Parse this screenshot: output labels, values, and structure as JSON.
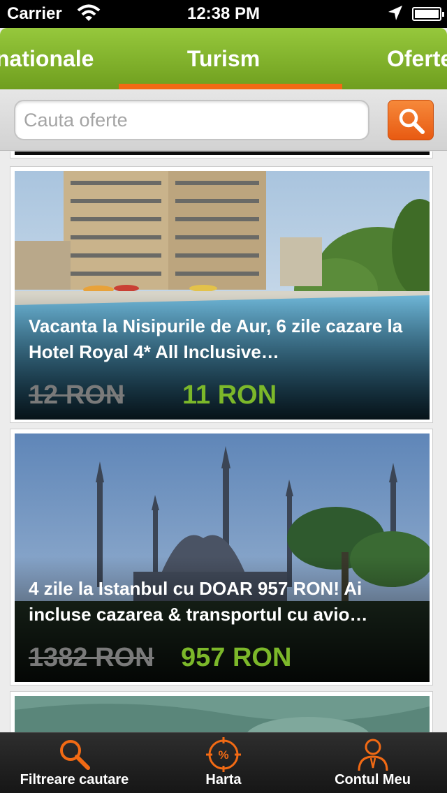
{
  "status_bar": {
    "carrier": "Carrier",
    "time": "12:38 PM"
  },
  "top_tabs": [
    {
      "label": "nationale"
    },
    {
      "label": "Turism"
    },
    {
      "label": "Oferte"
    }
  ],
  "search": {
    "placeholder": "Cauta oferte"
  },
  "offers": [
    {
      "title": "Vacanta la Nisipurile de Aur, 6 zile cazare la Hotel Royal 4* All Inclusive…",
      "old_price": "12 RON",
      "new_price": "11 RON"
    },
    {
      "title": "4 zile la Istanbul cu DOAR 957 RON! Ai incluse cazarea & transportul cu avio…",
      "old_price": "1382 RON",
      "new_price": "957 RON"
    }
  ],
  "bottom_nav": [
    {
      "label": "Filtreare cautare",
      "icon": "search-icon"
    },
    {
      "label": "Harta",
      "icon": "map-percent-icon"
    },
    {
      "label": "Contul Meu",
      "icon": "user-icon"
    }
  ],
  "colors": {
    "brand_green": "#7cb82a",
    "accent_orange": "#f26a14"
  }
}
